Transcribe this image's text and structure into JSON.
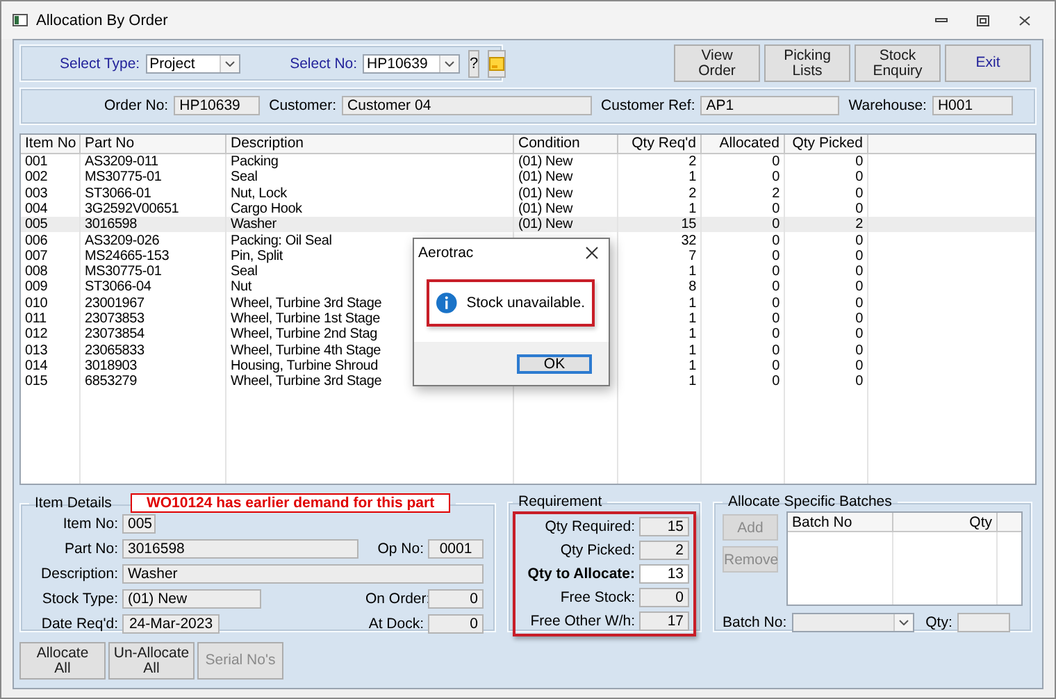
{
  "window": {
    "title": "Allocation By Order"
  },
  "selectors": [
    {
      "label": "Select Type:",
      "value": "Project"
    },
    {
      "label": "Select No:",
      "value": "HP10639"
    }
  ],
  "help_button": "?",
  "actions": [
    {
      "lines": [
        "View",
        "Order"
      ]
    },
    {
      "lines": [
        "Picking",
        "Lists"
      ]
    },
    {
      "lines": [
        "Stock",
        "Enquiry"
      ]
    },
    {
      "lines": [
        "Exit"
      ]
    }
  ],
  "header_fields": [
    {
      "label": "Order No:",
      "value": "HP10639"
    },
    {
      "label": "Customer:",
      "value": "Customer 04"
    },
    {
      "label": "Customer Ref:",
      "value": "AP1"
    },
    {
      "label": "Warehouse:",
      "value": "H001"
    }
  ],
  "table": {
    "columns": [
      "Item No",
      "Part No",
      "Description",
      "Condition",
      "Qty Req'd",
      "Allocated",
      "Qty Picked"
    ],
    "rows": [
      {
        "selected": false,
        "cells": [
          "001",
          "AS3209-011",
          "Packing",
          "(01) New",
          "2",
          "0",
          "0"
        ]
      },
      {
        "selected": false,
        "cells": [
          "002",
          "MS30775-01",
          "Seal",
          "(01) New",
          "1",
          "0",
          "0"
        ]
      },
      {
        "selected": false,
        "cells": [
          "003",
          "ST3066-01",
          "Nut, Lock",
          "(01) New",
          "2",
          "2",
          "0"
        ]
      },
      {
        "selected": false,
        "cells": [
          "004",
          "3G2592V00651",
          "Cargo Hook",
          "(01) New",
          "1",
          "0",
          "0"
        ]
      },
      {
        "selected": true,
        "cells": [
          "005",
          "3016598",
          "Washer",
          "(01) New",
          "15",
          "0",
          "2"
        ]
      },
      {
        "selected": false,
        "cells": [
          "006",
          "AS3209-026",
          "Packing: Oil Seal",
          null,
          "32",
          "0",
          "0"
        ]
      },
      {
        "selected": false,
        "cells": [
          "007",
          "MS24665-153",
          "Pin, Split",
          null,
          "7",
          "0",
          "0"
        ]
      },
      {
        "selected": false,
        "cells": [
          "008",
          "MS30775-01",
          "Seal",
          null,
          "1",
          "0",
          "0"
        ]
      },
      {
        "selected": false,
        "cells": [
          "009",
          "ST3066-04",
          "Nut",
          null,
          "8",
          "0",
          "0"
        ]
      },
      {
        "selected": false,
        "cells": [
          "010",
          "23001967",
          "Wheel, Turbine 3rd Stage",
          null,
          "1",
          "0",
          "0"
        ]
      },
      {
        "selected": false,
        "cells": [
          "011",
          "23073853",
          "Wheel, Turbine 1st Stage",
          null,
          "1",
          "0",
          "0"
        ]
      },
      {
        "selected": false,
        "cells": [
          "012",
          "23073854",
          "Wheel, Turbine 2nd Stag",
          null,
          "1",
          "0",
          "0"
        ]
      },
      {
        "selected": false,
        "cells": [
          "013",
          "23065833",
          "Wheel, Turbine 4th Stage",
          null,
          "1",
          "0",
          "0"
        ]
      },
      {
        "selected": false,
        "cells": [
          "014",
          "3018903",
          "Housing, Turbine Shroud",
          null,
          "1",
          "0",
          "0"
        ]
      },
      {
        "selected": false,
        "cells": [
          "015",
          "6853279",
          "Wheel, Turbine 3rd Stage",
          null,
          "1",
          "0",
          "0"
        ]
      }
    ]
  },
  "item_details": {
    "title": "Item Details",
    "warning": "WO10124 has earlier demand for this part",
    "item_no": {
      "label": "Item No:",
      "value": "005"
    },
    "part_no": {
      "label": "Part No:",
      "value": "3016598"
    },
    "op_no": {
      "label": "Op No:",
      "value": "0001"
    },
    "description": {
      "label": "Description:",
      "value": "Washer"
    },
    "stock_type": {
      "label": "Stock Type:",
      "value": "(01) New"
    },
    "on_order": {
      "label": "On Order:",
      "value": "0"
    },
    "date_reqd": {
      "label": "Date Req'd:",
      "value": "24-Mar-2023"
    },
    "at_dock": {
      "label": "At Dock:",
      "value": "0"
    }
  },
  "requirement": {
    "title": "Requirement",
    "fields": [
      {
        "label": "Qty Required:",
        "value": "15",
        "kind": "readonly"
      },
      {
        "label": "Qty Picked:",
        "value": "2",
        "kind": "readonly"
      },
      {
        "label": "Qty to Allocate:",
        "value": "13",
        "kind": "editable"
      },
      {
        "label": "Free Stock:",
        "value": "0",
        "kind": "readonly"
      },
      {
        "label": "Free Other W/h:",
        "value": "17",
        "kind": "readonly"
      }
    ]
  },
  "batches": {
    "title": "Allocate Specific Batches",
    "buttons": [
      {
        "label": "Add",
        "disabled": true
      },
      {
        "label": "Remove",
        "disabled": true
      }
    ],
    "columns": [
      "Batch No",
      "Qty"
    ],
    "batch_no_label": "Batch No:",
    "qty_label": "Qty:"
  },
  "bottom_buttons": [
    {
      "lines": [
        "Allocate",
        "All"
      ],
      "disabled": false
    },
    {
      "lines": [
        "Un-Allocate",
        "All"
      ],
      "disabled": false
    },
    {
      "lines": [
        "Serial No's"
      ],
      "disabled": true
    }
  ],
  "dialog": {
    "title": "Aerotrac",
    "message": "Stock unavailable.",
    "button": "OK"
  }
}
